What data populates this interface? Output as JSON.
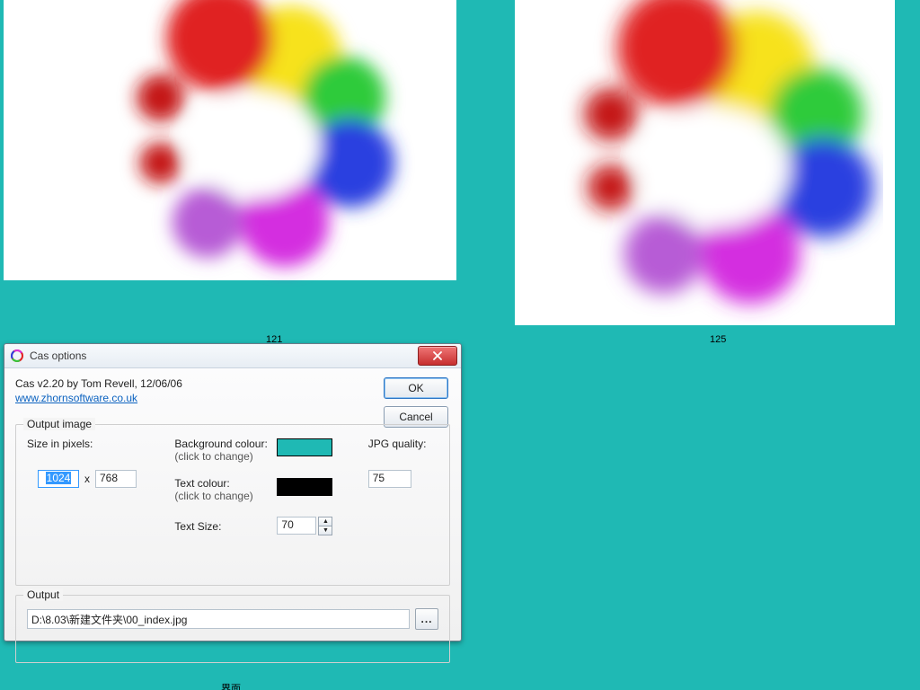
{
  "canvas": {
    "bg_color": "#1fb9b4"
  },
  "thumbnails": {
    "left_label": "121",
    "right_label": "125",
    "bottom_label": "界面"
  },
  "dialog": {
    "title": "Cas options",
    "credits": "Cas v2.20 by Tom Revell, 12/06/06",
    "website": "www.zhornsoftware.co.uk",
    "ok_label": "OK",
    "cancel_label": "Cancel",
    "close_tooltip": "Close",
    "group_output_image": {
      "legend": "Output image",
      "size_label": "Size in pixels:",
      "width_value": "1024",
      "x_label": "x",
      "height_value": "768",
      "bg_colour_label": "Background colour:",
      "click_to_change": "(click to change)",
      "bg_colour_value": "#1fb9b4",
      "text_colour_label": "Text colour:",
      "text_colour_value": "#000000",
      "text_size_label": "Text Size:",
      "text_size_value": "70",
      "jpg_quality_label": "JPG quality:",
      "jpg_quality_value": "75"
    },
    "group_output": {
      "legend": "Output",
      "path_value": "D:\\8.03\\新建文件夹\\00_index.jpg",
      "browse_label": "..."
    }
  }
}
